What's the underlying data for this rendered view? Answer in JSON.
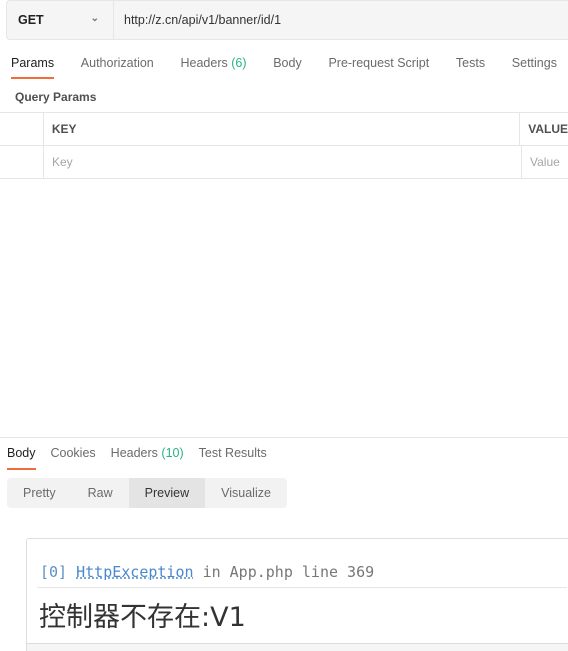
{
  "request": {
    "method": "GET",
    "url": "http://z.cn/api/v1/banner/id/1"
  },
  "request_tabs": [
    {
      "label": "Params"
    },
    {
      "label": "Authorization"
    },
    {
      "label": "Headers",
      "count": "(6)"
    },
    {
      "label": "Body"
    },
    {
      "label": "Pre-request Script"
    },
    {
      "label": "Tests"
    },
    {
      "label": "Settings"
    }
  ],
  "query_params": {
    "title": "Query Params",
    "headers": [
      "KEY",
      "VALUE"
    ],
    "placeholders": [
      "Key",
      "Value"
    ]
  },
  "response_tabs": [
    {
      "label": "Body"
    },
    {
      "label": "Cookies"
    },
    {
      "label": "Headers",
      "count": "(10)"
    },
    {
      "label": "Test Results"
    }
  ],
  "view_modes": [
    "Pretty",
    "Raw",
    "Preview",
    "Visualize"
  ],
  "preview": {
    "index": "[0]",
    "exception": "HttpException",
    "in": "in App.php line 369",
    "message": "控制器不存在:V1"
  },
  "colors": {
    "accent": "#f26b3a",
    "count": "#26b47f"
  }
}
